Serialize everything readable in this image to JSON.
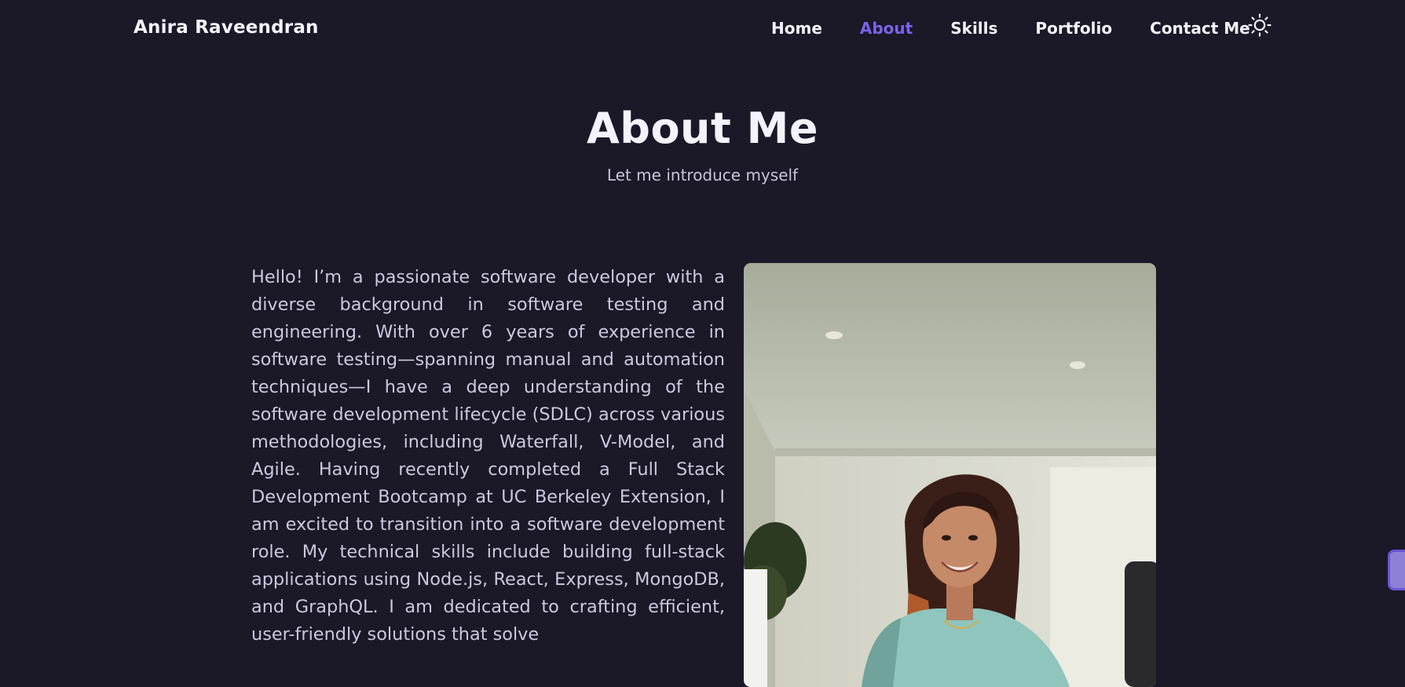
{
  "header": {
    "brand": "Anira Raveendran",
    "nav": [
      {
        "label": "Home",
        "active": false
      },
      {
        "label": "About",
        "active": true
      },
      {
        "label": "Skills",
        "active": false
      },
      {
        "label": "Portfolio",
        "active": false
      },
      {
        "label": "Contact Me",
        "active": false
      }
    ],
    "theme_toggle_icon": "sun-icon"
  },
  "about": {
    "title": "About Me",
    "subtitle": "Let me introduce myself",
    "bio": "Hello! I’m a passionate software developer with a diverse background in software testing and engineering. With over 6 years of experience in software testing—spanning manual and automation techniques—I have a deep understanding of the software development lifecycle (SDLC) across various methodologies, including Waterfall, V-Model, and Agile. Having recently completed a Full Stack Development Bootcamp at UC Berkeley Extension, I am excited to transition into a software development role. My technical skills include building full-stack applications using Node.js, React, Express, MongoDB, and GraphQL. I am dedicated to crafting efficient, user-friendly solutions that solve",
    "photo_icon": "profile-photo"
  },
  "colors": {
    "background": "#1b1828",
    "accent": "#7b63e6",
    "text": "#f4f2fa",
    "muted_text": "#cdc8de"
  }
}
